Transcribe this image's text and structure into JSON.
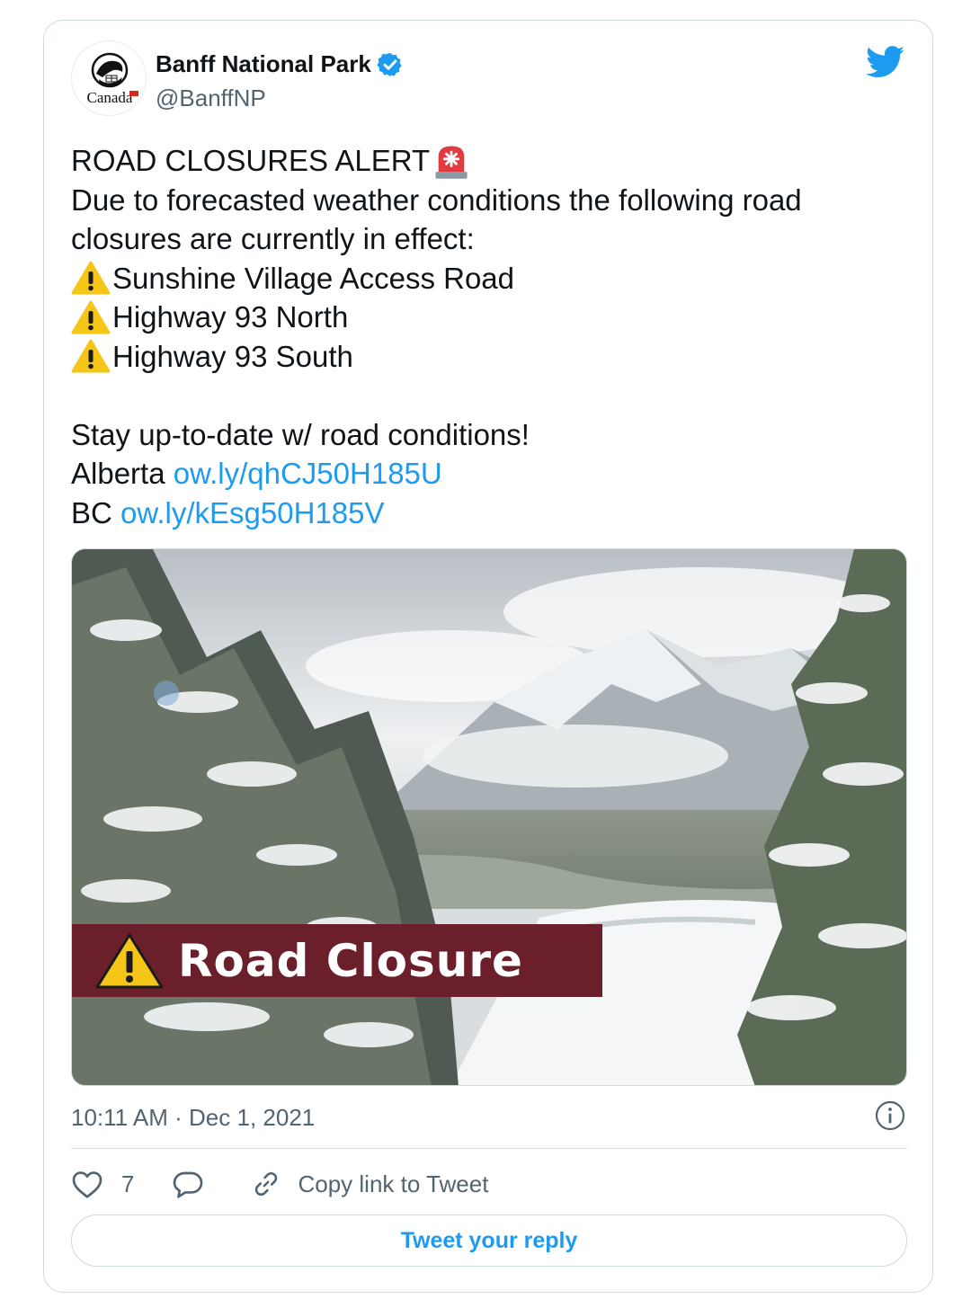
{
  "author": {
    "display_name": "Banff National Park",
    "handle": "@BanffNP",
    "avatar_word": "Canada"
  },
  "icons": {
    "verified": "verified-badge-icon",
    "brand": "twitter-bird-icon",
    "alert": "rotating-light-emoji",
    "warning": "warning-emoji",
    "info": "info-icon",
    "like": "heart-icon",
    "reply": "speech-bubble-icon",
    "copy": "link-icon"
  },
  "tweet": {
    "headline": "ROAD CLOSURES ALERT",
    "line1": "Due to forecasted weather conditions the following road",
    "line2": "closures are currently in effect:",
    "roads": [
      "Sunshine Village Access Road",
      "Highway 93 North",
      "Highway 93 South"
    ],
    "cta": "Stay up-to-date w/ road conditions!",
    "alberta_label": "Alberta",
    "alberta_link": "ow.ly/qhCJ50H185U",
    "bc_label": "BC",
    "bc_link": "ow.ly/kEsg50H185V"
  },
  "media": {
    "banner_text": "Road Closure",
    "banner_color": "#6b1f2a"
  },
  "meta": {
    "timestamp": "10:11 AM · Dec 1, 2021"
  },
  "actions": {
    "like_count": "7",
    "copy_label": "Copy link to Tweet",
    "reply_prompt": "Tweet your reply"
  },
  "colors": {
    "accent": "#1d9bf0",
    "text": "#0f1419",
    "secondary": "#536471",
    "border": "#cfd9de"
  }
}
